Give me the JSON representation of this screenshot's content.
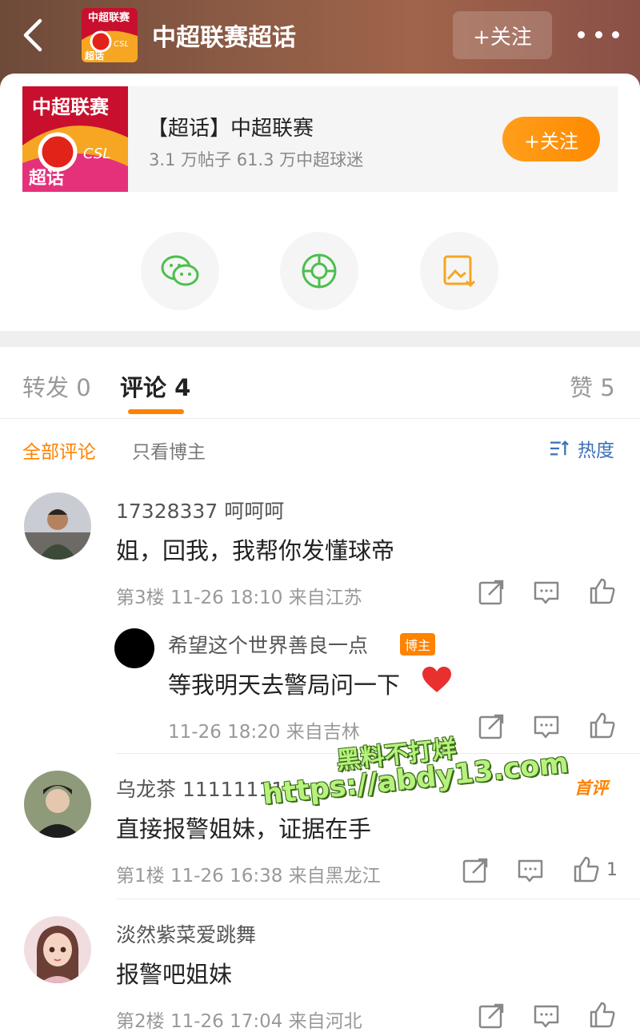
{
  "header": {
    "title": "中超联赛超话",
    "follow_label": "+关注"
  },
  "topic": {
    "name": "【超话】中超联赛",
    "stats": "3.1 万帖子 61.3 万中超球迷",
    "follow_label": "+关注",
    "logo_lines": [
      "中超联赛",
      "CSL",
      "超话"
    ]
  },
  "share": [
    "wechat-icon",
    "moments-icon",
    "save-image-icon"
  ],
  "tabs": [
    {
      "label": "转发 0"
    },
    {
      "label": "评论 4"
    },
    {
      "label": "赞 5"
    }
  ],
  "filters": {
    "all": "全部评论",
    "owner_only": "只看博主",
    "sort": "热度"
  },
  "comments": [
    {
      "user": "17328337 呵呵呵",
      "text": "姐，回我，我帮你发懂球帝",
      "meta": "第3楼  11-26 18:10  来自江苏",
      "reply": {
        "user": "希望这个世界善良一点",
        "badge": "博主",
        "text": "等我明天去警局问一下",
        "meta": "11-26 18:20  来自吉林"
      }
    },
    {
      "user": "乌龙茶 11111111",
      "tag": "首评",
      "text": "直接报警姐妹，证据在手",
      "meta": "第1楼  11-26 16:38  来自黑龙江",
      "likes": "1"
    },
    {
      "user": "淡然紫菜爱跳舞",
      "text": "报警吧姐妹",
      "meta": "第2楼  11-26 17:04  来自河北"
    }
  ],
  "watermark": {
    "line1": "黑料不打烊",
    "line2": "https://abdy13.com"
  },
  "colors": {
    "accent": "#ff8200",
    "link": "#3d70b8",
    "wechat": "#4cbf4c"
  }
}
